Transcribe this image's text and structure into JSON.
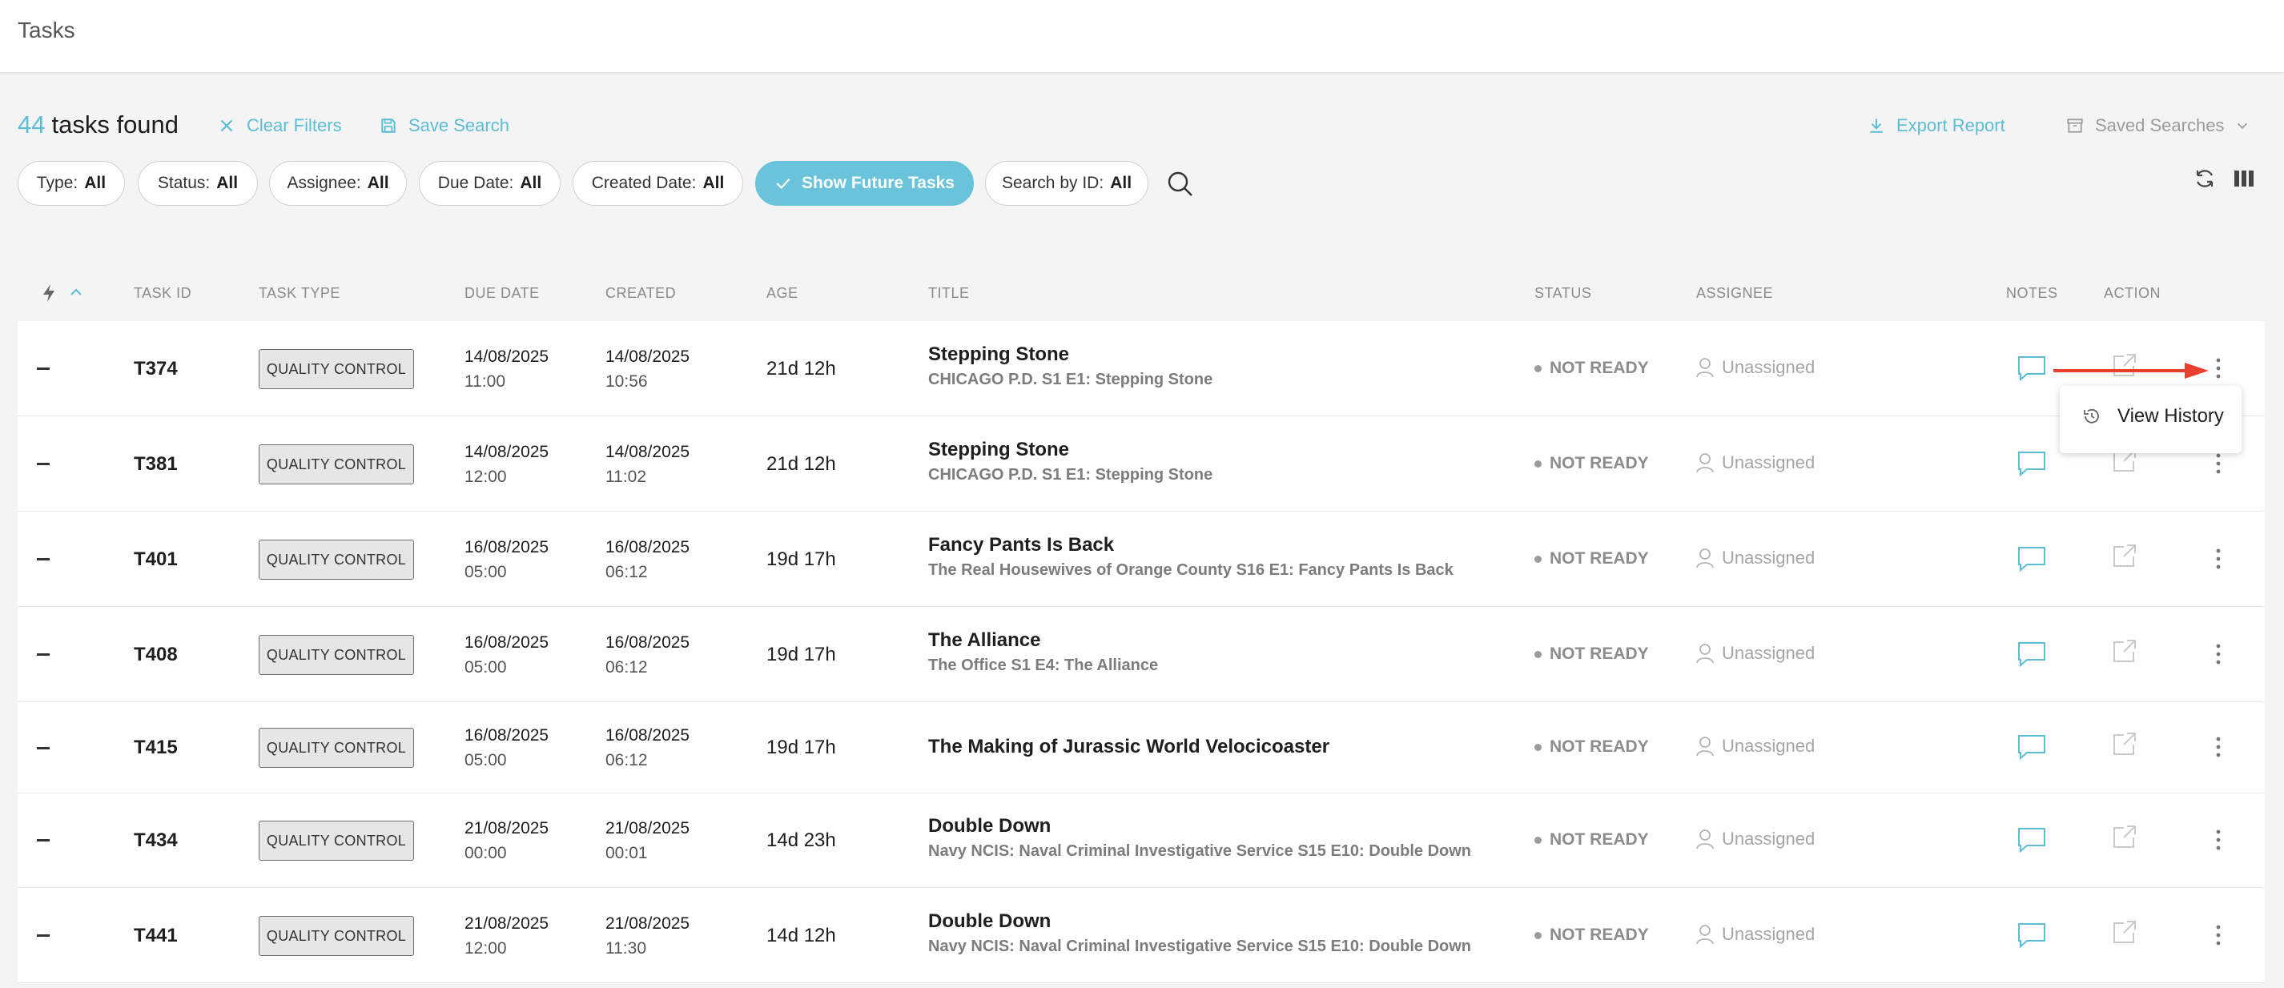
{
  "header": {
    "title": "Tasks"
  },
  "summary": {
    "count": "44",
    "found_label": "tasks found"
  },
  "actions": {
    "clear_filters": "Clear Filters",
    "save_search": "Save Search",
    "export_report": "Export Report",
    "saved_searches": "Saved Searches"
  },
  "filters": {
    "type": {
      "label": "Type:",
      "value": "All"
    },
    "status": {
      "label": "Status:",
      "value": "All"
    },
    "assignee": {
      "label": "Assignee:",
      "value": "All"
    },
    "due_date": {
      "label": "Due Date:",
      "value": "All"
    },
    "created_date": {
      "label": "Created Date:",
      "value": "All"
    },
    "future_tasks": "Show Future Tasks",
    "search_id": {
      "label": "Search by ID:",
      "value": "All"
    }
  },
  "columns": {
    "task_id": "TASK ID",
    "task_type": "TASK TYPE",
    "due_date": "DUE DATE",
    "created": "CREATED",
    "age": "AGE",
    "title": "TITLE",
    "status": "STATUS",
    "assignee": "ASSIGNEE",
    "notes": "NOTES",
    "action": "ACTION"
  },
  "rows": [
    {
      "id": "T374",
      "type": "QUALITY CONTROL",
      "due_date": "14/08/2025",
      "due_time": "11:00",
      "created_date": "14/08/2025",
      "created_time": "10:56",
      "age": "21d 12h",
      "title": "Stepping Stone",
      "subtitle": "CHICAGO P.D. S1 E1: Stepping Stone",
      "status": "NOT READY",
      "assignee": "Unassigned"
    },
    {
      "id": "T381",
      "type": "QUALITY CONTROL",
      "due_date": "14/08/2025",
      "due_time": "12:00",
      "created_date": "14/08/2025",
      "created_time": "11:02",
      "age": "21d 12h",
      "title": "Stepping Stone",
      "subtitle": "CHICAGO P.D. S1 E1: Stepping Stone",
      "status": "NOT READY",
      "assignee": "Unassigned"
    },
    {
      "id": "T401",
      "type": "QUALITY CONTROL",
      "due_date": "16/08/2025",
      "due_time": "05:00",
      "created_date": "16/08/2025",
      "created_time": "06:12",
      "age": "19d 17h",
      "title": "Fancy Pants Is Back",
      "subtitle": "The Real Housewives of Orange County S16 E1: Fancy Pants Is Back",
      "status": "NOT READY",
      "assignee": "Unassigned"
    },
    {
      "id": "T408",
      "type": "QUALITY CONTROL",
      "due_date": "16/08/2025",
      "due_time": "05:00",
      "created_date": "16/08/2025",
      "created_time": "06:12",
      "age": "19d 17h",
      "title": "The Alliance",
      "subtitle": "The Office S1 E4: The Alliance",
      "status": "NOT READY",
      "assignee": "Unassigned"
    },
    {
      "id": "T415",
      "type": "QUALITY CONTROL",
      "due_date": "16/08/2025",
      "due_time": "05:00",
      "created_date": "16/08/2025",
      "created_time": "06:12",
      "age": "19d 17h",
      "title": "The Making of Jurassic World Velocicoaster",
      "subtitle": "",
      "status": "NOT READY",
      "assignee": "Unassigned"
    },
    {
      "id": "T434",
      "type": "QUALITY CONTROL",
      "due_date": "21/08/2025",
      "due_time": "00:00",
      "created_date": "21/08/2025",
      "created_time": "00:01",
      "age": "14d 23h",
      "title": "Double Down",
      "subtitle": "Navy NCIS: Naval Criminal Investigative Service S15 E10: Double Down",
      "status": "NOT READY",
      "assignee": "Unassigned"
    },
    {
      "id": "T441",
      "type": "QUALITY CONTROL",
      "due_date": "21/08/2025",
      "due_time": "12:00",
      "created_date": "21/08/2025",
      "created_time": "11:30",
      "age": "14d 12h",
      "title": "Double Down",
      "subtitle": "Navy NCIS: Naval Criminal Investigative Service S15 E10: Double Down",
      "status": "NOT READY",
      "assignee": "Unassigned"
    }
  ],
  "context_menu": {
    "view_history": "View History"
  },
  "icons": {
    "clear": "close-icon",
    "save": "save-icon",
    "export": "download-icon",
    "saved_searches": "archive-icon",
    "search": "search-icon",
    "refresh": "refresh-icon",
    "columns": "columns-icon",
    "priority": "lightning-icon",
    "sort": "chevron-up-icon",
    "notes": "comment-icon",
    "open": "external-link-icon",
    "more": "more-vertical-icon",
    "history": "history-icon",
    "user": "user-icon"
  },
  "colors": {
    "accent": "#5bbdd6",
    "active_chip": "#69c3da",
    "arrow": "#e8412f",
    "status_grey": "#8c8c8c"
  }
}
